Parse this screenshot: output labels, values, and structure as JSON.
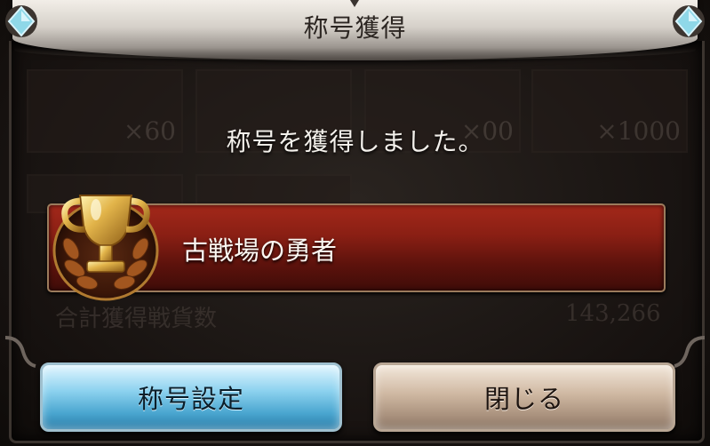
{
  "dialog": {
    "title": "称号獲得",
    "message": "称号を獲得しました。",
    "awarded_title": "古戦場の勇者",
    "trophy_icon": "gold-trophy-icon"
  },
  "buttons": {
    "set_title_label": "称号設定",
    "close_label": "閉じる"
  },
  "background": {
    "item_counts": [
      "×60",
      "×00",
      "×1000"
    ],
    "total_label": "合計獲得戦貨数",
    "total_value": "143,266"
  },
  "colors": {
    "banner_red": "#8a1f14",
    "button_blue": "#8dd2ef",
    "button_beige": "#cfb8a2",
    "gem_cyan": "#8fd8e8"
  }
}
